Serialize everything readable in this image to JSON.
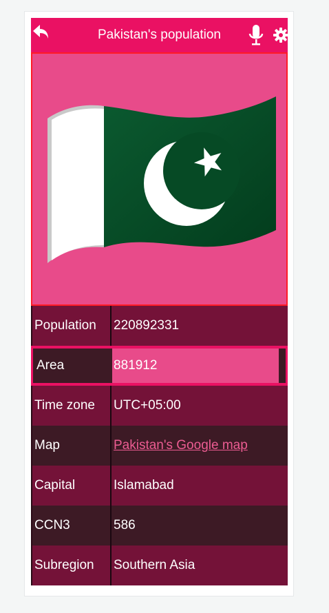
{
  "header": {
    "title": "Pakistan's population",
    "back_icon": "back-arrow-icon",
    "mic_icon": "microphone-icon",
    "settings_icon": "gear-icon",
    "color": "#ea1163"
  },
  "flag": {
    "country": "Pakistan",
    "background": "#e84b8a",
    "border": "#ff1b27"
  },
  "rows": [
    {
      "label": "Population",
      "value": "220892331"
    },
    {
      "label": "Area",
      "value": "881912"
    },
    {
      "label": "Time zone",
      "value": "UTC+05:00"
    },
    {
      "label": "Map",
      "value": "Pakistan's Google map"
    },
    {
      "label": "Capital",
      "value": "Islamabad"
    },
    {
      "label": "CCN3",
      "value": "586"
    },
    {
      "label": "Subregion",
      "value": "Southern Asia"
    }
  ],
  "colors": {
    "row_odd": "#741238",
    "row_even": "#3d1a25",
    "selected_value_bg": "#e84b8a",
    "link": "#ec5c92"
  }
}
